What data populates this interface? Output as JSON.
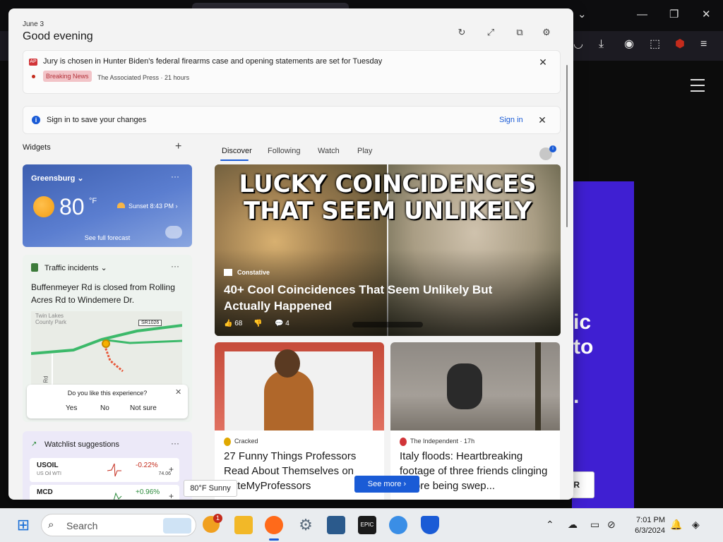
{
  "header": {
    "date": "June 3",
    "greeting": "Good evening"
  },
  "breaking": {
    "title": "Jury is chosen in Hunter Biden's federal firearms case and opening statements are set for Tuesday",
    "tag": "Breaking News",
    "source": "The Associated Press · 21 hours"
  },
  "signin": {
    "text": "Sign in to save your changes",
    "link": "Sign in"
  },
  "widgets": {
    "label": "Widgets",
    "add": "+"
  },
  "weather": {
    "location": "Greensburg",
    "temp": "80",
    "unit": "°F",
    "sunset": "Sunset 8:43 PM",
    "forecast_link": "See full forecast",
    "menu": "···"
  },
  "traffic": {
    "title": "Traffic incidents",
    "menu": "···",
    "description": "Buffenmeyer Rd is closed from Rolling Acres Rd to Windemere Dr.",
    "map_place": "Twin Lakes County Park",
    "road_tag": "SR1026",
    "road_side": "Rd"
  },
  "survey": {
    "question": "Do you like this experience?",
    "yes": "Yes",
    "no": "No",
    "not_sure": "Not sure"
  },
  "watchlist": {
    "title": "Watchlist suggestions",
    "menu": "···",
    "stocks": [
      {
        "symbol": "USOIL",
        "name": "US Oil WTI",
        "change": "-0.22%",
        "price": "74.06",
        "color": "#c42b1c"
      },
      {
        "symbol": "MCD",
        "name": "",
        "change": "+0.96%",
        "price": "",
        "color": "#2a8a3a"
      }
    ]
  },
  "tabs": [
    "Discover",
    "Following",
    "Watch",
    "Play"
  ],
  "hero": {
    "caption_line1": "LUCKY COINCIDENCES",
    "caption_line2": "THAT SEEM UNLIKELY",
    "source": "Constative",
    "title": "40+ Cool Coincidences That Seem Unlikely But Actually Happened",
    "likes": "68",
    "comments": "4"
  },
  "cards": [
    {
      "source": "Cracked",
      "title": "27 Funny Things Professors Read About Themselves on RateMyProfessors",
      "icon_color": "#e0a800"
    },
    {
      "source": "The Independent · 17h",
      "title": "Italy floods: Heartbreaking footage of three friends clinging before being swep...",
      "icon_color": "#d13438"
    }
  ],
  "see_more": "See more",
  "tooltip": "80°F Sunny",
  "background": {
    "banner_line1": "ic",
    "banner_line2": "to",
    "banner_dot": ".",
    "button": "ER"
  },
  "taskbar": {
    "search_placeholder": "Search",
    "notif_count": "1",
    "time": "7:01 PM",
    "date": "6/3/2024"
  }
}
